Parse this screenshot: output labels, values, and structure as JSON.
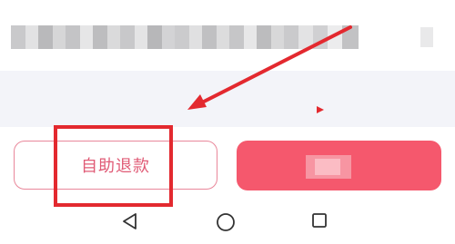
{
  "actions": {
    "self_refund_label": "自助退款",
    "primary_label": ""
  },
  "navbar": {
    "back_icon": "triangle-back-icon",
    "home_icon": "circle-home-icon",
    "recents_icon": "square-recents-icon"
  },
  "annotation": {
    "box_color": "#e3292f",
    "arrow_color": "#e3292f"
  },
  "colors": {
    "accent": "#f5586d",
    "outline": "#e9879a",
    "band": "#f3f4f9"
  }
}
